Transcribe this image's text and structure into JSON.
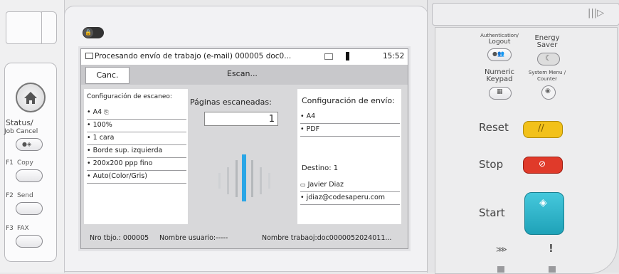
{
  "left": {
    "status_label": "Status/",
    "job_cancel_label": "Job Cancel",
    "f1": "F1",
    "copy": "Copy",
    "f2": "F2",
    "send": "Send",
    "f3": "F3",
    "fax": "FAX"
  },
  "screen": {
    "status_text": "Procesando envío de trabajo (e-mail) 000005 doc0...",
    "time": "15:52",
    "cancel_label": "Canc.",
    "scanning_label": "Escan...",
    "scan_config_title": "Configuración de escaneo:",
    "scan_config_items": [
      "A4",
      "100%",
      "1 cara",
      "Borde sup. izquierda",
      "200x200 ppp fino",
      "Auto(Color/Gris)"
    ],
    "pages_title": "Páginas escaneadas:",
    "pages_value": "1",
    "send_config_title": "Configuración de envío:",
    "send_config_items": [
      "A4",
      "PDF"
    ],
    "destination_label": "Destino: 1",
    "destination_name": "Javier Diaz",
    "destination_email": "jdiaz@codesaperu.com",
    "job_no": "Nro tbjo.: 000005",
    "user_name": "Nombre usuario:-----",
    "job_name": "Nombre trabaoj:doc0000052024011..."
  },
  "right": {
    "auth_label1": "Authentication/",
    "auth_label2": "Logout",
    "energy_label1": "Energy",
    "energy_label2": "Saver",
    "numeric_label1": "Numeric",
    "numeric_label2": "Keypad",
    "sysmenu_label1": "System Menu /",
    "sysmenu_label2": "Counter",
    "reset": "Reset",
    "stop": "Stop",
    "start": "Start",
    "exclamation": "!",
    "colors": {
      "reset": "#f2c11a",
      "stop": "#e03a2a",
      "start": "#33b8cc"
    }
  }
}
